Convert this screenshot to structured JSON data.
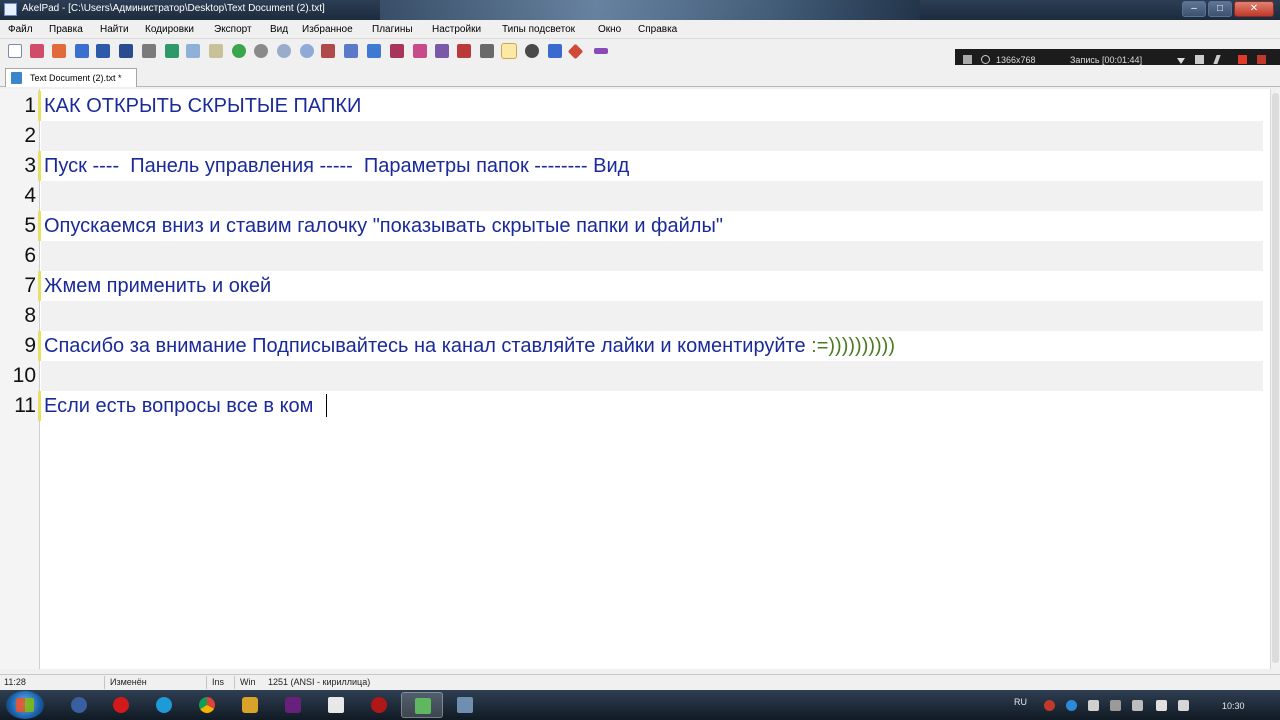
{
  "window": {
    "title": "AkelPad - [C:\\Users\\Администратор\\Desktop\\Text Document (2).txt]",
    "controls": [
      "–",
      "□",
      "✕"
    ]
  },
  "menu": [
    "Файл",
    "Правка",
    "Найти",
    "Кодировки",
    "Экспорт",
    "Вид",
    "Избранное",
    "Плагины",
    "Настройки",
    "Типы подсветок",
    "Окно",
    "Справка"
  ],
  "recorder": {
    "resolution": "1366x768",
    "status": "Запись [00:01:44]"
  },
  "tab": {
    "label": "Text Document (2).txt *"
  },
  "editor": {
    "line_numbers": [
      "1",
      "2",
      "3",
      "4",
      "5",
      "6",
      "7",
      "8",
      "9",
      "10",
      "11"
    ],
    "lines": [
      "КАК ОТКРЫТЬ СКРЫТЫЕ ПАПКИ",
      "",
      "Пуск ----  Панель управления -----  Параметры папок -------- Вид",
      "",
      "Опускаемся вниз и ставим галочку \"показывать скрытые папки и файлы\"",
      "",
      "Жмем применить и окей",
      "",
      "Спасибо за внимание Подписывайтесь на канал ставляйте лайки и коментируйте ",
      "",
      "Если есть вопросы все в ком"
    ],
    "line9_emoticon": ":=))))))))))"
  },
  "statusbar": {
    "position": "11:28",
    "modified": "Изменён",
    "insert_mode": "Ins",
    "newline": "Win",
    "codepage": "1251  (ANSI - кириллица)"
  },
  "taskbar": {
    "language": "RU",
    "clock": "10:30"
  },
  "colors": {
    "text": "#1a2a9a",
    "emoticon": "#4b7a22",
    "alt_row": "#f1f1f1",
    "margin_marker": "#e8e064"
  }
}
